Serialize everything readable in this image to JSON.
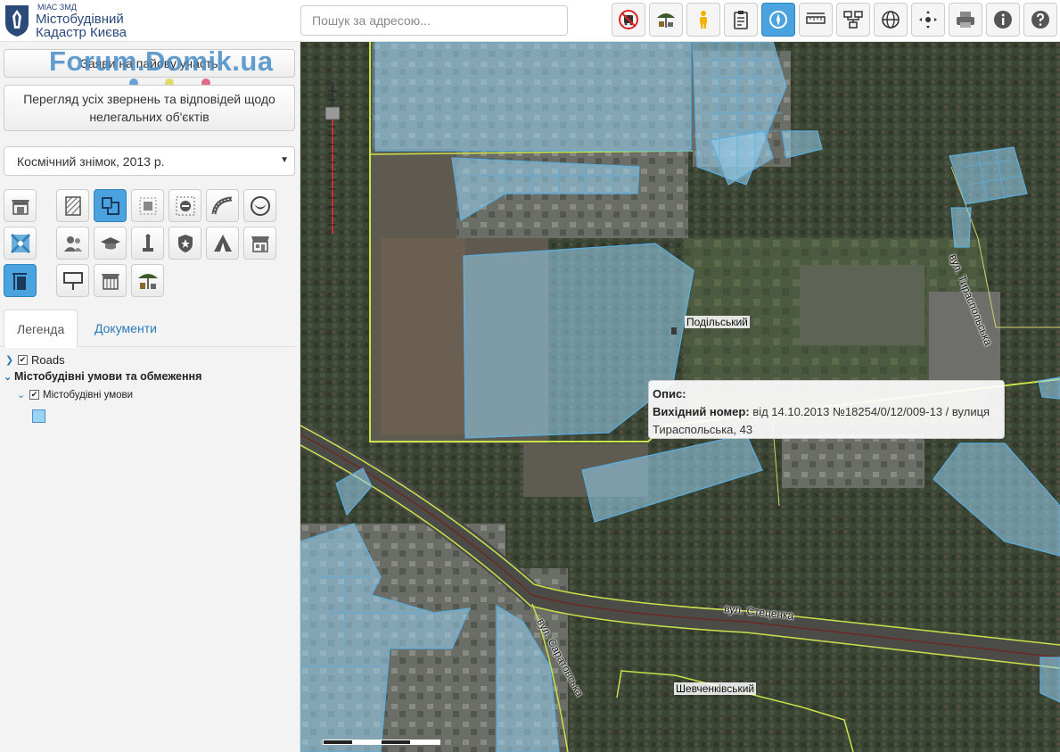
{
  "logo": {
    "small": "МІАС ЗМД",
    "line1": "Містобудівний",
    "line2": "Кадастр Києва"
  },
  "search": {
    "placeholder": "Пошук за адресою..."
  },
  "toolbar": {
    "tools": [
      "no-transport-icon",
      "kiosk-umbrella-icon",
      "person-icon",
      "clipboard-icon",
      "compass-icon",
      "ruler-icon",
      "network-icon",
      "globe-icon",
      "move-arrows-icon",
      "printer-icon",
      "info-icon",
      "help-icon"
    ],
    "active": "compass-icon"
  },
  "sidebar": {
    "watermark": "Forum.Domik.ua",
    "btn_applications": "Заяви на пайову участь",
    "btn_appeals": "Перегляд усіх звернень та відповідей щодо нелегальних об'єктів",
    "select_value": "Космічний знімок, 2013 р."
  },
  "tabs": {
    "legend": "Легенда",
    "documents": "Документи"
  },
  "legend": {
    "roads": "Roads",
    "group": "Містобудівні умови та обмеження",
    "sublayer": "Містобудівні умови"
  },
  "map": {
    "district_podilskyi": "Подільський",
    "district_shevchenkivskyi": "Шевченківський",
    "street_tyraspolska": "вул. Тираспольська",
    "street_stetsenka": "вул. Стеценка",
    "street_saratovska": "вул. Саратовська"
  },
  "popup": {
    "title": "Опис:",
    "label": "Вихідний номер:",
    "value": "від 14.10.2013 №18254/0/12/009-13 / вулиця Тираспольська, 43"
  },
  "colors": {
    "accent": "#4aa3df",
    "parcel_fill": "#99d4f2",
    "road_line": "#c8e34a"
  }
}
